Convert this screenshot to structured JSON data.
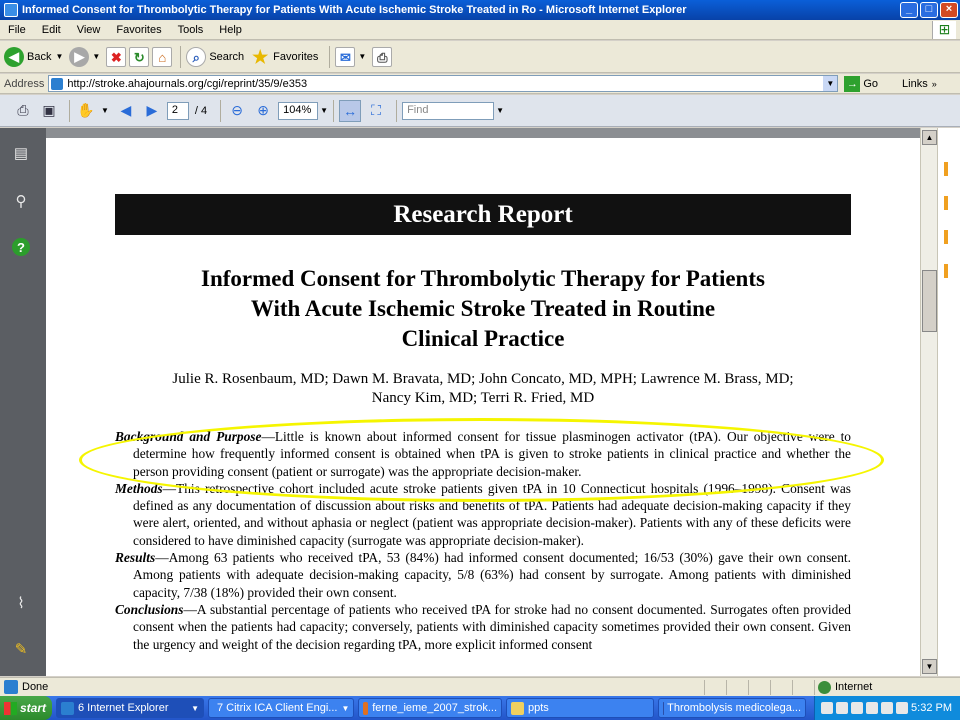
{
  "window": {
    "title": "Informed Consent for Thrombolytic Therapy for Patients With Acute Ischemic Stroke Treated in Ro - Microsoft Internet Explorer",
    "min": "_",
    "max": "□",
    "close": "×"
  },
  "menu": [
    "File",
    "Edit",
    "View",
    "Favorites",
    "Tools",
    "Help"
  ],
  "toolbar": {
    "back": "Back",
    "search": "Search",
    "favorites": "Favorites"
  },
  "address": {
    "label": "Address",
    "url": "http://stroke.ahajournals.org/cgi/reprint/35/9/e353",
    "go": "Go",
    "links": "Links"
  },
  "pdf": {
    "page_current": "2",
    "page_total": "/ 4",
    "zoom": "104%",
    "find_placeholder": "Find"
  },
  "document": {
    "banner": "Research Report",
    "title_lines": [
      "Informed Consent for Thrombolytic Therapy for Patients",
      "With Acute Ischemic Stroke Treated in Routine",
      "Clinical Practice"
    ],
    "authors_lines": [
      "Julie R. Rosenbaum, MD; Dawn M. Bravata, MD; John Concato, MD, MPH; Lawrence M. Brass, MD;",
      "Nancy Kim, MD; Terri R. Fried, MD"
    ],
    "sections": [
      {
        "head": "Background and Purpose",
        "body": "—Little is known about informed consent for tissue plasminogen activator (tPA). Our objective were to determine how frequently informed consent is obtained when tPA is given to stroke patients in clinical practice and whether the person providing consent (patient or surrogate) was the appropriate decision-maker."
      },
      {
        "head": "Methods",
        "body": "—This retrospective cohort included acute stroke patients given tPA in 10 Connecticut hospitals (1996–1998). Consent was defined as any documentation of discussion about risks and benefits of tPA. Patients had adequate decision-making capacity if they were alert, oriented, and without aphasia or neglect (patient was appropriate decision-maker). Patients with any of these deficits were considered to have diminished capacity (surrogate was appropriate decision-maker)."
      },
      {
        "head": "Results",
        "body": "—Among 63 patients who received tPA, 53 (84%) had informed consent documented; 16/53 (30%) gave their own consent. Among patients with adequate decision-making capacity, 5/8 (63%) had consent by surrogate. Among patients with diminished capacity, 7/38 (18%) provided their own consent."
      },
      {
        "head": "Conclusions",
        "body": "—A substantial percentage of patients who received tPA for stroke had no consent documented. Surrogates often provided consent when the patients had capacity; conversely, patients with diminished capacity sometimes provided their own consent. Given the urgency and weight of the decision regarding tPA, more explicit informed consent"
      }
    ],
    "highlight_color": "#f5f500"
  },
  "status": {
    "text": "Done",
    "zone": "Internet"
  },
  "taskbar": {
    "start": "start",
    "tasks": [
      "6 Internet Explorer",
      "7 Citrix ICA Client Engi...",
      "ferne_ieme_2007_strok...",
      "ppts",
      "Thrombolysis medicolega..."
    ],
    "clock": "5:32 PM"
  }
}
